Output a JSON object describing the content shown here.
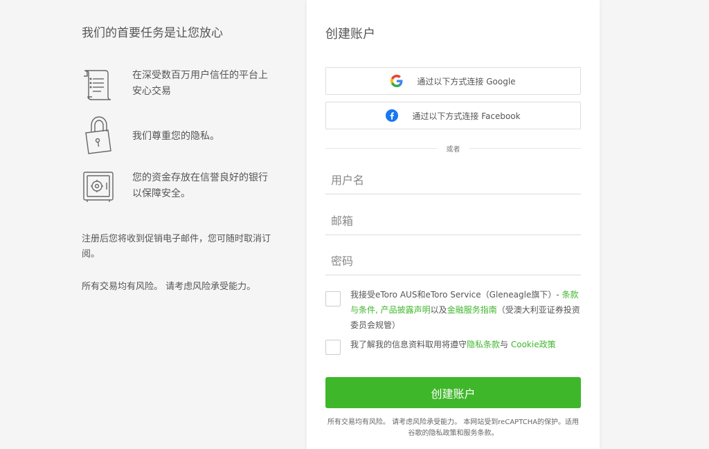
{
  "left": {
    "title": "我们的首要任务是让您放心",
    "features": [
      {
        "icon": "scroll-list-icon",
        "text": "在深受数百万用户信任的平台上安心交易"
      },
      {
        "icon": "padlock-icon",
        "text": "我们尊重您的隐私。"
      },
      {
        "icon": "safe-vault-icon",
        "text": "您的资金存放在信誉良好的银行以保障安全。"
      }
    ],
    "note_promo": "注册后您将收到促销电子邮件，您可随时取消订阅。",
    "note_risk": "所有交易均有风险。 请考虑风险承受能力。"
  },
  "form": {
    "title": "创建账户",
    "google_label": "通过以下方式连接 Google",
    "facebook_label": "通过以下方式连接 Facebook",
    "or_label": "或者",
    "username_placeholder": "用户名",
    "email_placeholder": "邮箱",
    "password_placeholder": "密码",
    "terms": {
      "prefix": "我接受eToro AUS和eToro Service（Gleneagle旗下）- ",
      "link1": "条款与条件",
      "sep1": ", ",
      "link2": "产品披露声明",
      "sep2": "以及",
      "link3": "金融服务指南",
      "suffix": "（受澳大利亚证券投资委员会规管）"
    },
    "privacy": {
      "prefix": "我了解我的信息资料取用将遵守",
      "link1": "隐私条款",
      "sep": "与 ",
      "link2": "Cookie政策"
    },
    "submit_label": "创建账户",
    "footer": "所有交易均有风险。 请考虑风险承受能力。 本网站受到reCAPTCHA的保护。适用谷歌的隐私政策和服务条款。"
  },
  "colors": {
    "accent_green": "#3fb72a",
    "google_blue": "#4285f4",
    "google_red": "#ea4335",
    "google_yellow": "#fbbc05",
    "google_green": "#34a853",
    "facebook_blue": "#1877f2"
  }
}
